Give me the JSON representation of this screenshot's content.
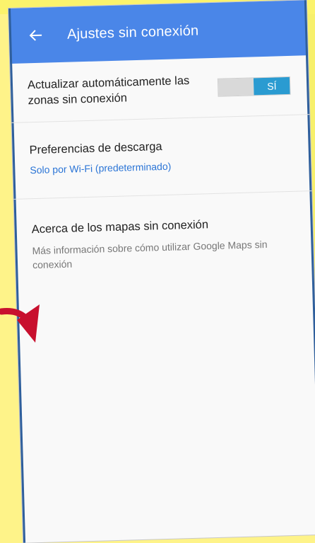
{
  "appbar": {
    "title": "Ajustes sin conexión",
    "back_icon": "arrow-left-icon"
  },
  "settings": {
    "auto_update": {
      "label": "Actualizar automáticamente las zonas sin conexión",
      "toggle_label": "SÍ",
      "enabled": true
    },
    "download_prefs": {
      "title": "Preferencias de descarga",
      "value": "Solo por Wi-Fi (predeterminado)"
    },
    "about": {
      "title": "Acerca de los mapas sin conexión",
      "description": "Más información sobre cómo utilizar Google Maps sin conexión"
    }
  },
  "colors": {
    "appbar": "#4a86e8",
    "toggle_on": "#2a9bd1",
    "link": "#2a74d6",
    "background_yellow": "#fef389",
    "annotation_arrow": "#c8102e"
  },
  "annotation": {
    "icon": "red-curved-arrow-icon"
  }
}
